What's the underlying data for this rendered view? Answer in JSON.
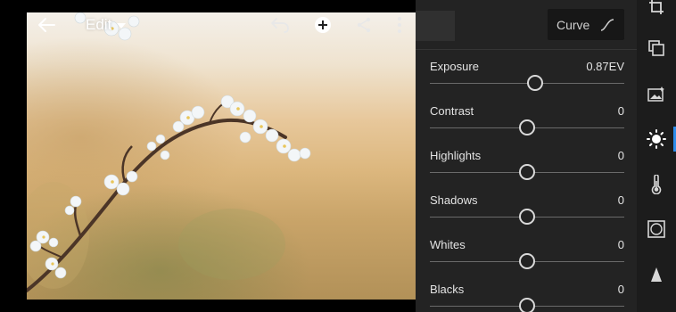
{
  "header": {
    "title": "Edit",
    "back_icon": "arrow-left-icon",
    "undo_icon": "undo-icon",
    "add_icon": "add-circle-icon",
    "share_icon": "share-icon",
    "more_icon": "more-vertical-icon"
  },
  "panel": {
    "curve_button_label": "Curve",
    "curve_icon": "curve-icon",
    "sliders": [
      {
        "label": "Exposure",
        "value": "0.87EV",
        "position": 0.5435
      },
      {
        "label": "Contrast",
        "value": "0",
        "position": 0.5
      },
      {
        "label": "Highlights",
        "value": "0",
        "position": 0.5
      },
      {
        "label": "Shadows",
        "value": "0",
        "position": 0.5
      },
      {
        "label": "Whites",
        "value": "0",
        "position": 0.5
      },
      {
        "label": "Blacks",
        "value": "0",
        "position": 0.5
      }
    ]
  },
  "rail": {
    "items": [
      {
        "name": "crop-icon",
        "active": false
      },
      {
        "name": "presets-icon",
        "active": false
      },
      {
        "name": "auto-enhance-icon",
        "active": false
      },
      {
        "name": "light-icon",
        "active": true
      },
      {
        "name": "color-icon",
        "active": false
      },
      {
        "name": "vignette-icon",
        "active": false
      },
      {
        "name": "detail-icon",
        "active": false
      }
    ]
  },
  "colors": {
    "panel_bg": "#232323",
    "rail_bg": "#1c1c1c",
    "accent": "#2d8ceb",
    "slider_thumb": "#d9d9d9"
  }
}
